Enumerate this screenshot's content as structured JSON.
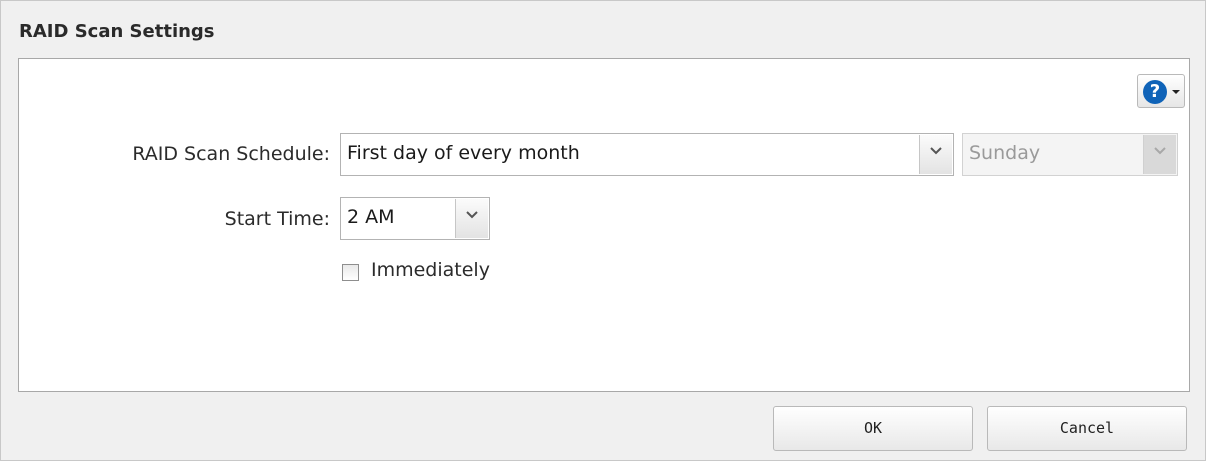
{
  "dialog": {
    "title": "RAID Scan Settings"
  },
  "help": {
    "icon": "help-icon",
    "glyph": "?"
  },
  "form": {
    "schedule": {
      "label": "RAID Scan Schedule:",
      "value": "First day of every month",
      "day_value": "Sunday",
      "day_disabled": true
    },
    "start_time": {
      "label": "Start Time:",
      "value": "2 AM"
    },
    "immediately": {
      "label": "Immediately",
      "checked": false
    }
  },
  "buttons": {
    "ok": "OK",
    "cancel": "Cancel"
  }
}
